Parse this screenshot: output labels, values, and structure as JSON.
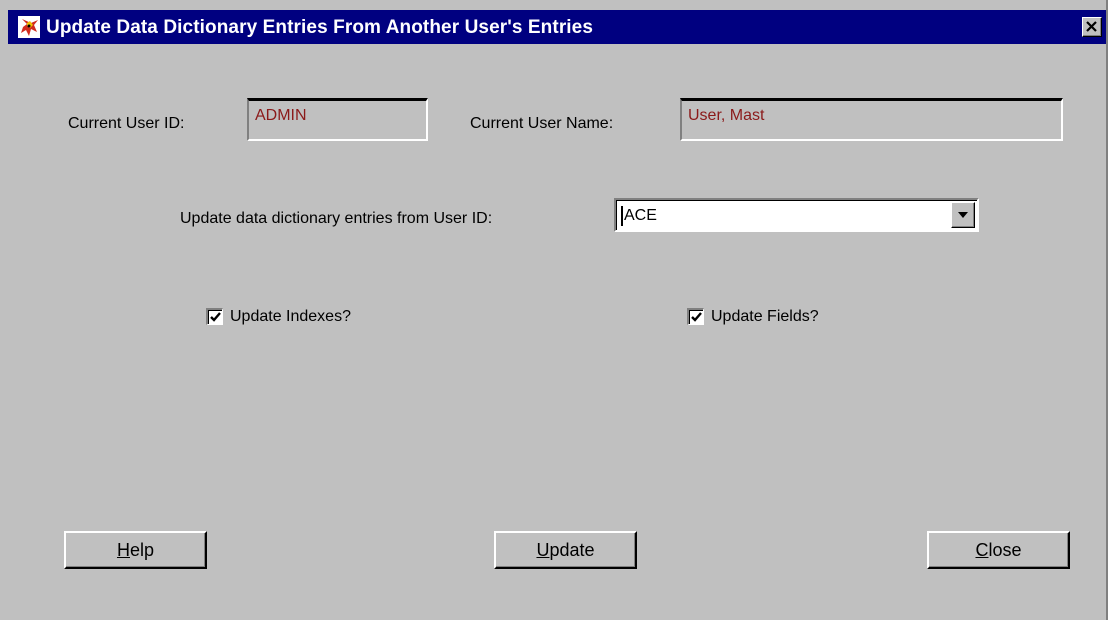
{
  "window": {
    "title": "Update Data Dictionary Entries From Another User's Entries",
    "close_glyph": "✕"
  },
  "current_user": {
    "id_label": "Current User ID:",
    "id_value": "ADMIN",
    "name_label": "Current User Name:",
    "name_value": "User, Mast"
  },
  "source": {
    "label": "Update data dictionary entries from User ID:",
    "selected_value": "ACE"
  },
  "options": {
    "update_indexes_label": "Update Indexes?",
    "update_indexes_checked": true,
    "update_fields_label": "Update Fields?",
    "update_fields_checked": true
  },
  "buttons": {
    "help_mnemonic": "H",
    "help_rest": "elp",
    "update_mnemonic": "U",
    "update_rest": "pdate",
    "close_mnemonic": "C",
    "close_rest": "lose"
  },
  "colors": {
    "titlebar": "#000080",
    "dialog_bg": "#c0c0c0",
    "readonly_text": "#8b1a1a"
  }
}
